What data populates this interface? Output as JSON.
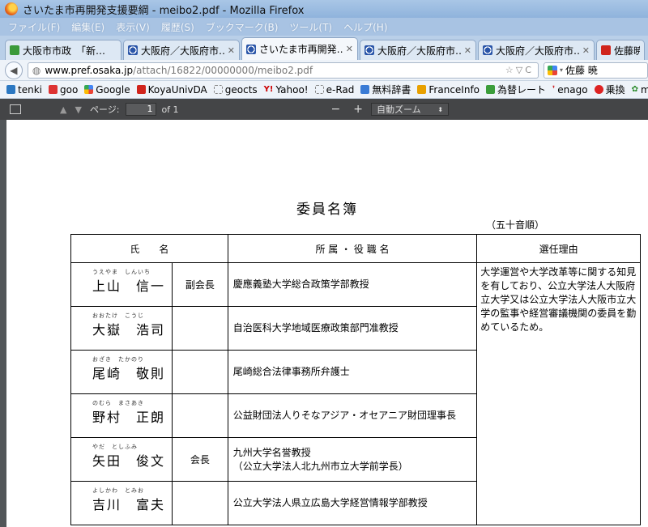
{
  "window": {
    "title": "さいたま市再開発支援要綱 - meibo2.pdf - Mozilla Firefox"
  },
  "menu": [
    "ファイル(F)",
    "編集(E)",
    "表示(V)",
    "履歴(S)",
    "ブックマーク(B)",
    "ツール(T)",
    "ヘルプ(H)"
  ],
  "tabs": [
    {
      "label": "大阪市市政　「新…",
      "icon": "green-city-icon"
    },
    {
      "label": "大阪府／大阪府市…",
      "icon": "osaka-pref-icon"
    },
    {
      "label": "さいたま市再開発…",
      "icon": "osaka-pref-icon",
      "active": true
    },
    {
      "label": "大阪府／大阪府市…",
      "icon": "osaka-pref-icon"
    },
    {
      "label": "大阪府／大阪府市…",
      "icon": "osaka-pref-icon"
    },
    {
      "label": "佐藤暁：",
      "icon": "youtube-icon"
    }
  ],
  "nav": {
    "url_host": "www.pref.osaka.jp",
    "url_path": "/attach/16822/00000000/meibo2.pdf",
    "search_value": "佐藤 暁"
  },
  "bookmarks": [
    "tenki",
    "goo",
    "Google",
    "KoyaUnivDA",
    "geocts",
    "Yahoo!",
    "e-Rad",
    "無料辞書",
    "FranceInfo",
    "為替レート",
    "enago",
    "乗換",
    "msn"
  ],
  "pdf_toolbar": {
    "page_label": "ページ:",
    "page_value": "1",
    "page_of": "of 1",
    "zoom": "自動ズーム",
    "minus": "−",
    "plus": "+"
  },
  "document": {
    "title": "委員名簿",
    "order_note": "（五十音順）",
    "headers": {
      "name": "氏　　名",
      "affiliation": "所 属 ・ 役 職 名",
      "reason": "選任理由"
    },
    "members": [
      {
        "name": "上山　信一",
        "ruby": "うえやま　しんいち",
        "role": "副会長",
        "affiliation": "慶應義塾大学総合政策学部教授"
      },
      {
        "name": "大嶽　浩司",
        "ruby": "おおたけ　こうじ",
        "role": "",
        "affiliation": "自治医科大学地域医療政策部門准教授"
      },
      {
        "name": "尾崎　敬則",
        "ruby": "おざき　たかのり",
        "role": "",
        "affiliation": "尾崎総合法律事務所弁護士"
      },
      {
        "name": "野村　正朗",
        "ruby": "のむら　まさあき",
        "role": "",
        "affiliation": "公益財団法人りそなアジア・オセアニア財団理事長"
      },
      {
        "name": "矢田　俊文",
        "ruby": "やだ　としふみ",
        "role": "会長",
        "affiliation": "九州大学名誉教授\n（公立大学法人北九州市立大学前学長）"
      },
      {
        "name": "吉川　富夫",
        "ruby": "よしかわ　とみお",
        "role": "",
        "affiliation": "公立大学法人県立広島大学経営情報学部教授"
      }
    ],
    "reason_text": "大学運営や大学改革等に関する知見を有しており、公立大学法人大阪府立大学又は公立大学法人大阪市立大学の監事や経営審議機関の委員を勤めているため。"
  }
}
